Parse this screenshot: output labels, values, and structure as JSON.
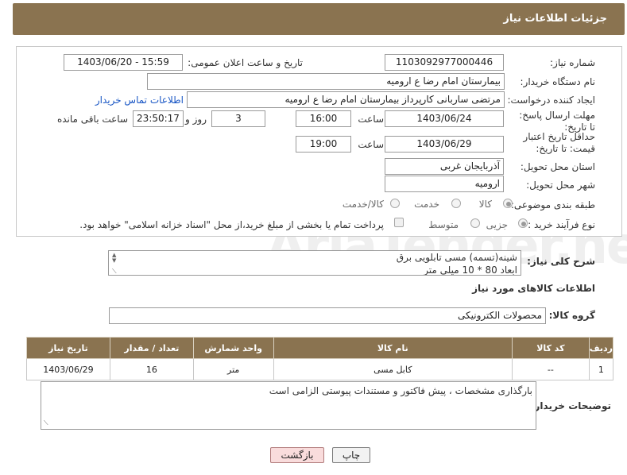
{
  "header": {
    "title": "جزئیات اطلاعات نیاز"
  },
  "form": {
    "need_number": {
      "label": "شماره نیاز:",
      "value": "1103092977000446"
    },
    "announce": {
      "label": "تاریخ و ساعت اعلان عمومی:",
      "value": "1403/06/20 - 15:59"
    },
    "buyer_org": {
      "label": "نام دستگاه خریدار:",
      "value": "بیمارستان امام رضا  ع  ارومیه"
    },
    "requester": {
      "label": "ایجاد کننده درخواست:",
      "value": "مرتضی ساربانی کارپرداز بیمارستان امام رضا  ع  ارومیه",
      "contact_link": "اطلاعات تماس خریدار"
    },
    "reply_deadline": {
      "label": "مهلت ارسال پاسخ: تا تاریخ:",
      "date": "1403/06/24",
      "time_label": "ساعت",
      "time": "16:00",
      "days": "3",
      "days_label": "روز و",
      "remaining": "23:50:17",
      "remaining_label": "ساعت باقی مانده"
    },
    "price_validity": {
      "label": "حداقل تاریخ اعتبار قیمت: تا تاریخ:",
      "date": "1403/06/29",
      "time_label": "ساعت",
      "time": "19:00"
    },
    "province": {
      "label": "استان محل تحویل:",
      "value": "آذربایجان غربی"
    },
    "city": {
      "label": "شهر محل تحویل:",
      "value": "ارومیه"
    },
    "category": {
      "label": "طبقه بندی موضوعی:",
      "options": [
        "کالا",
        "خدمت",
        "کالا/خدمت"
      ],
      "selected": "کالا"
    },
    "purchase_type": {
      "label": "نوع فرآیند خرید :",
      "options": [
        "جزیی",
        "متوسط"
      ],
      "note": "پرداخت تمام یا بخشی از مبلغ خرید،از محل \"اسناد خزانه اسلامی\" خواهد بود."
    }
  },
  "description": {
    "label": "شرح کلی نیاز:",
    "line1": "شینه(تسمه) مسی تابلویی برق",
    "line2": "ابعاد 80 * 10 میلی متر"
  },
  "goods_section": {
    "title": "اطلاعات کالاهای مورد نیاز",
    "group_label": "گروه کالا:",
    "group_value": "محصولات الکترونیکی"
  },
  "table": {
    "headers": [
      "ردیف",
      "کد کالا",
      "نام کالا",
      "واحد شمارش",
      "تعداد / مقدار",
      "تاریخ نیاز"
    ],
    "rows": [
      [
        "1",
        "--",
        "کابل مسی",
        "متر",
        "16",
        "1403/06/29"
      ]
    ]
  },
  "buyer_notes": {
    "label": "توضیحات خریدار:",
    "value": "بارگذاری مشخصات ، پیش فاکتور و مستندات پیوستی الزامی است"
  },
  "buttons": {
    "print": "چاپ",
    "back": "بازگشت"
  },
  "watermark": "AriaTender.net"
}
